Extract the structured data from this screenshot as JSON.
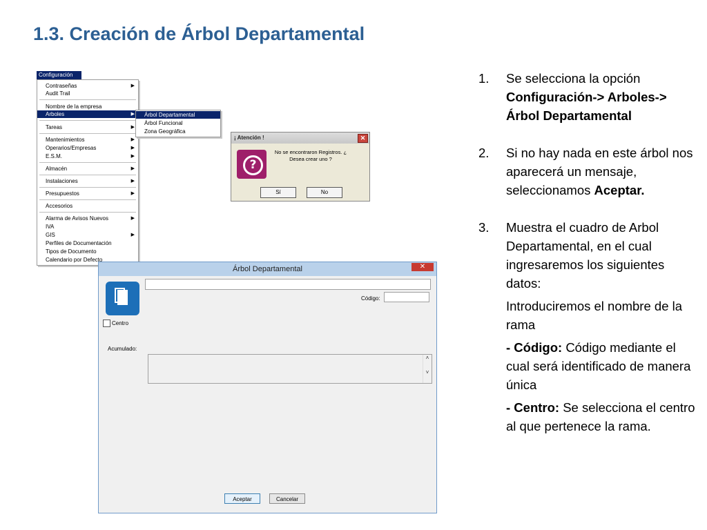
{
  "title": "1.3. Creación de Árbol Departamental",
  "menu": {
    "header": "Configuración",
    "items": [
      "Contraseñas",
      "Audit Trail",
      "Nombre de la empresa",
      "Arboles",
      "Tareas",
      "Mantenimientos",
      "Operarios/Empresas",
      "E.S.M.",
      "Almacén",
      "Instalaciones",
      "Presupuestos",
      "Accesorios",
      "Alarma de Avisos Nuevos",
      "IVA",
      "GIS",
      "Perfiles de Documentación",
      "Tipos de Documento",
      "Calendario por Defecto"
    ],
    "submenu": [
      "Árbol Departamental",
      "Árbol Funcional",
      "Zona Geográfica"
    ]
  },
  "alert": {
    "title": "¡ Atención !",
    "message": "No se encontraron Registros. ¿ Desea crear uno ?",
    "yes": "Sí",
    "no": "No",
    "close": "✕"
  },
  "dialog": {
    "title": "Árbol Departamental",
    "codigo_label": "Código:",
    "centro_label": "Centro",
    "acumulado_label": "Acumulado:",
    "accept": "Aceptar",
    "cancel": "Cancelar",
    "close": "✕",
    "scroll_up": "˄",
    "scroll_down": "˅"
  },
  "steps": {
    "s1_num": "1.",
    "s1_text": "Se selecciona la opción",
    "s1_bold": "Configuración-> Arboles-> Árbol Departamental",
    "s2_num": "2.",
    "s2_text": "Si no hay nada en este árbol nos aparecerá un mensaje, seleccionamos",
    "s2_bold": "Aceptar.",
    "s3_num": "3.",
    "s3_text": "Muestra el cuadro de Arbol Departamental, en el cual ingresaremos los siguientes datos:",
    "s3_a": "Introduciremos el nombre de la rama",
    "s3_b_bold": "- Código:",
    "s3_b_text": "Código mediante el cual será identificado de manera única",
    "s3_c_bold": "- Centro:",
    "s3_c_text": "Se selecciona el centro al que pertenece la rama."
  }
}
